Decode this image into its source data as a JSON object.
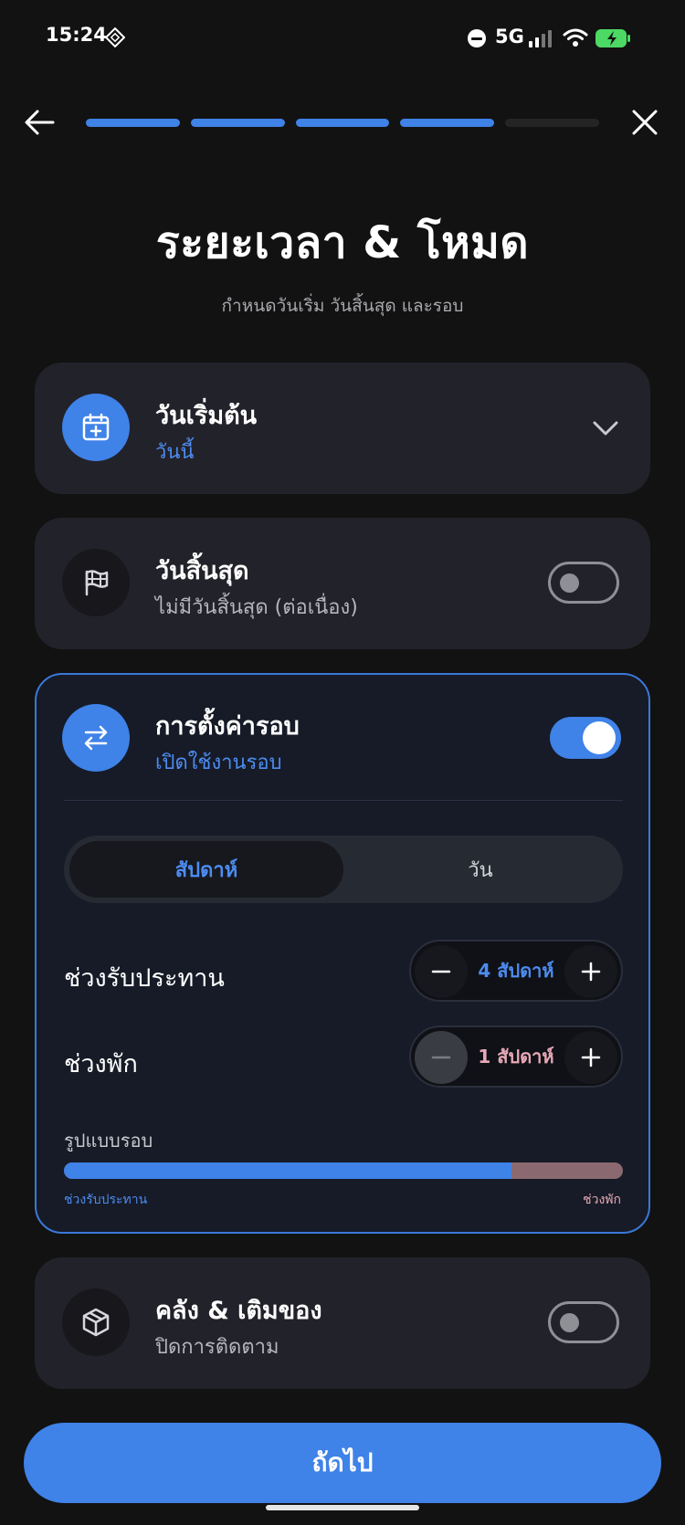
{
  "status_bar": {
    "time": "15:24",
    "network": "5G"
  },
  "header": {
    "progress_steps_total": 5,
    "progress_steps_done": 4
  },
  "page": {
    "title": "ระยะเวลา & โหมด",
    "subtitle": "กำหนดวันเริ่ม วันสิ้นสุด และรอบ"
  },
  "start_date": {
    "title": "วันเริ่มต้น",
    "value": "วันนี้",
    "icon": "calendar-plus-icon"
  },
  "end_date": {
    "title": "วันสิ้นสุด",
    "value": "ไม่มีวันสิ้นสุด (ต่อเนื่อง)",
    "icon": "flag-icon",
    "enabled": false
  },
  "cycle": {
    "title": "การตั้งค่ารอบ",
    "value": "เปิดใช้งานรอบ",
    "icon": "swap-arrows-icon",
    "enabled": true,
    "unit_options": [
      "สัปดาห์",
      "วัน"
    ],
    "selected_unit": "สัปดาห์",
    "intake_label": "ช่วงรับประทาน",
    "intake_value": "4 สัปดาห์",
    "break_label": "ช่วงพัก",
    "break_value": "1 สัปดาห์",
    "pattern_label": "รูปแบบรอบ",
    "pattern_intake_label": "ช่วงรับประทาน",
    "pattern_break_label": "ช่วงพัก",
    "pattern_intake_fraction": 0.8,
    "intake_color": "#3f82e8",
    "break_color": "#8a6a70"
  },
  "inventory": {
    "title": "คลัง & เติมของ",
    "value": "ปิดการติดตาม",
    "icon": "package-icon",
    "enabled": false
  },
  "footer": {
    "next_label": "ถัดไป"
  },
  "colors": {
    "accent": "#3f82e8",
    "background": "#121212",
    "card": "#22222a"
  }
}
